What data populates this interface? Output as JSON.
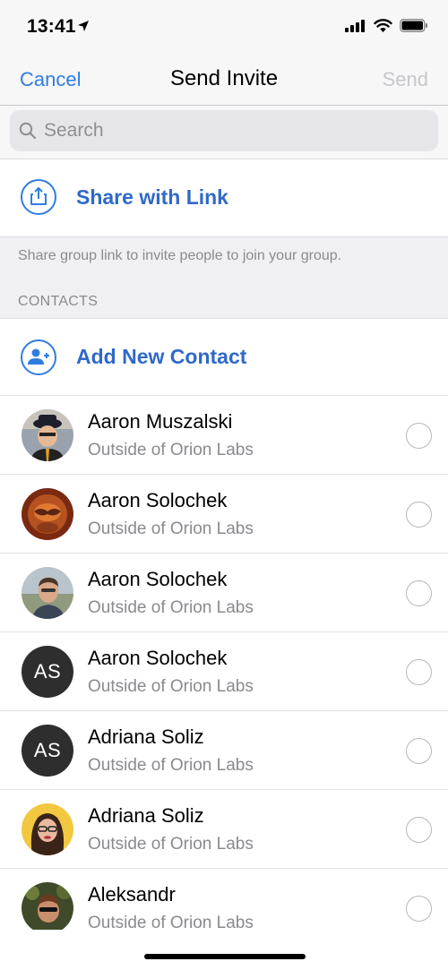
{
  "status_bar": {
    "time": "13:41",
    "icons": [
      "location-arrow-icon",
      "signal-bars-icon",
      "wifi-icon",
      "battery-icon"
    ]
  },
  "nav": {
    "cancel_label": "Cancel",
    "title": "Send Invite",
    "send_label": "Send"
  },
  "search": {
    "placeholder": "Search",
    "value": ""
  },
  "share": {
    "label": "Share with Link",
    "icon": "share-upload-icon",
    "hint": "Share group link to invite people to join your group."
  },
  "contacts_section": {
    "header": "CONTACTS"
  },
  "add_contact": {
    "label": "Add New Contact",
    "icon": "add-person-icon"
  },
  "contacts": [
    {
      "name": "Aaron Muszalski",
      "subtitle": "Outside of Orion Labs",
      "avatar_type": "photo",
      "avatar_initials": "",
      "selected": false
    },
    {
      "name": "Aaron Solochek",
      "subtitle": "Outside of Orion Labs",
      "avatar_type": "photo",
      "avatar_initials": "",
      "selected": false
    },
    {
      "name": "Aaron Solochek",
      "subtitle": "Outside of Orion Labs",
      "avatar_type": "photo",
      "avatar_initials": "",
      "selected": false
    },
    {
      "name": "Aaron Solochek",
      "subtitle": "Outside of Orion Labs",
      "avatar_type": "initials",
      "avatar_initials": "AS",
      "selected": false
    },
    {
      "name": "Adriana Soliz",
      "subtitle": "Outside of Orion Labs",
      "avatar_type": "initials",
      "avatar_initials": "AS",
      "selected": false
    },
    {
      "name": "Adriana Soliz",
      "subtitle": "Outside of Orion Labs",
      "avatar_type": "photo",
      "avatar_initials": "",
      "selected": false
    },
    {
      "name": "Aleksandr",
      "subtitle": "Outside of Orion Labs",
      "avatar_type": "photo",
      "avatar_initials": "",
      "selected": false
    }
  ],
  "colors": {
    "accent": "#2f7de1",
    "accent_bold": "#2f69c8",
    "disabled": "#c7c7cc",
    "secondary_text": "#8a8a8f",
    "group_background": "#efeff4"
  }
}
